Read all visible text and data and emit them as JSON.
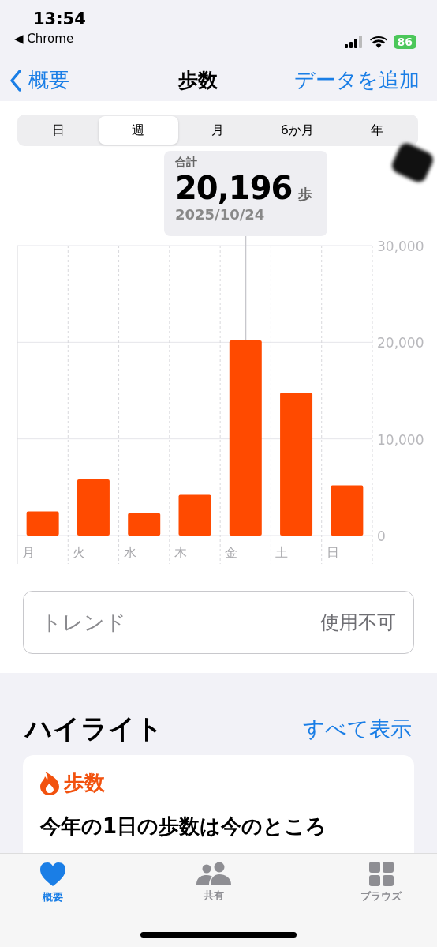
{
  "status_bar": {
    "time": "13:54",
    "back_app": "◀ Chrome",
    "battery": "86"
  },
  "nav": {
    "back": "概要",
    "title": "歩数",
    "action": "データを追加"
  },
  "segments": [
    {
      "label": "日",
      "selected": false
    },
    {
      "label": "週",
      "selected": true
    },
    {
      "label": "月",
      "selected": false
    },
    {
      "label": "6か月",
      "selected": false
    },
    {
      "label": "年",
      "selected": false
    }
  ],
  "tooltip": {
    "label": "合計",
    "value": "20,196",
    "unit": "歩",
    "date": "2025/10/24"
  },
  "chart_data": {
    "type": "bar",
    "categories": [
      "月",
      "火",
      "水",
      "木",
      "金",
      "土",
      "日"
    ],
    "values": [
      2500,
      5800,
      2300,
      4200,
      20200,
      14800,
      5200
    ],
    "ylim": [
      0,
      30000
    ],
    "yticks": [
      {
        "value": 0,
        "label": "0"
      },
      {
        "value": 10000,
        "label": "10,000"
      },
      {
        "value": 20000,
        "label": "20,000"
      },
      {
        "value": 30000,
        "label": "30,000"
      }
    ],
    "annotations": [
      {
        "x": "金"
      }
    ]
  },
  "trend": {
    "label": "トレンド",
    "value": "使用不可"
  },
  "highlights": {
    "title": "ハイライト",
    "action": "すべて表示",
    "card": {
      "category": "歩数",
      "text": "今年の1日の歩数は今のところ"
    }
  },
  "tab_bar": [
    {
      "label": "概要",
      "kind": "heart",
      "selected": true
    },
    {
      "label": "共有",
      "kind": "people",
      "selected": false
    },
    {
      "label": "ブラウズ",
      "kind": "grid",
      "selected": false
    }
  ]
}
